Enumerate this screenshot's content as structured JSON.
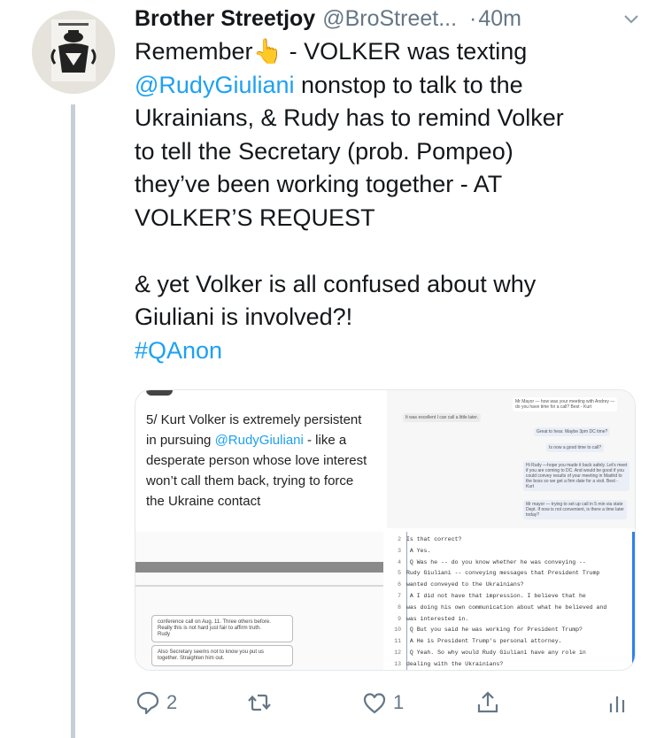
{
  "author": {
    "name": "Brother Streetjoy",
    "handle": "@BroStreet...",
    "dot": "·",
    "time": "40m"
  },
  "tweet": {
    "lines": [
      {
        "text": "Remember",
        "emoji": "👆",
        "rest": " - VOLKER was texting"
      },
      {
        "mention": "@RudyGiuliani",
        "rest": " nonstop to talk to the"
      },
      {
        "text": "Ukrainians, & Rudy has to remind Volker"
      },
      {
        "text": "to tell the Secretary (prob. Pompeo)"
      },
      {
        "text": "they’ve been working together - AT"
      },
      {
        "text": "VOLKER’S REQUEST"
      },
      {
        "text": ""
      },
      {
        "text": "& yet Volker is all confused about why"
      },
      {
        "text": "Giuliani is involved?!"
      }
    ],
    "hashtag": "#QAnon"
  },
  "media": {
    "q1": {
      "lines": [
        "5/ Kurt Volker is extremely persistent",
        "in pursuing ",
        "desperate person whose love interest",
        "won’t call them back, trying to force",
        "the Ukraine contact"
      ],
      "mention": "@RudyGiuliani",
      "mention_rest": " - like a"
    },
    "q2": {
      "messages": [
        "Mr Mayor — how was your meeting with Andrey —",
        "do you have time for a call? Best - Kurt",
        "It was excellent I can call a little later.",
        "Great to hear. Maybe 3pm DC time?",
        "Is now a good time to call?",
        "Hi Rudy —hope you made it back safely. Let’s meet",
        "if you are coming to DC. And would be good if you",
        "could convey results of your meeting in Madrid to",
        "the boss so we get a firm date for a visit. Best -",
        "Kurt",
        "Mr mayor — trying to set up call in 5 min via state",
        "Dept. If now is not convenient, is there a time later",
        "today?"
      ]
    },
    "q3": {
      "box1": [
        "conference call on Aug. 11. Three others before.",
        "Really this is not hard just fair to affirm truth.",
        "Rudy"
      ],
      "box2": [
        "Also Secretary seems not to know you put us",
        "together. Straighten him out."
      ]
    },
    "q4": {
      "lines": [
        {
          "n": "2",
          "t": "Is that correct?"
        },
        {
          "n": "3",
          "t": "      A    Yes."
        },
        {
          "n": "4",
          "t": "      Q    Was he -- do you know whether he was conveying --"
        },
        {
          "n": "5",
          "t": "Rudy Giuliani -- conveying messages that President Trump"
        },
        {
          "n": "6",
          "t": "wanted conveyed to the Ukrainians?"
        },
        {
          "n": "7",
          "t": "      A    I did not have that impression.  I believe that he"
        },
        {
          "n": "8",
          "t": "was doing his own communication about what he believed and"
        },
        {
          "n": "9",
          "t": "was interested in."
        },
        {
          "n": "10",
          "t": "      Q    But you said he was working for President Trump?"
        },
        {
          "n": "11",
          "t": "      A    He is President Trump's personal attorney."
        },
        {
          "n": "12",
          "t": "      Q    Yeah.  So why would Rudy Giuliani have any role in"
        },
        {
          "n": "13",
          "t": "dealing with the Ukrainians?"
        }
      ]
    }
  },
  "actions": {
    "reply_count": "2",
    "retweet_count": "",
    "like_count": "1"
  },
  "colors": {
    "link": "#1da1f2",
    "secondary": "#657786",
    "thread_line": "#c4cfd6"
  }
}
